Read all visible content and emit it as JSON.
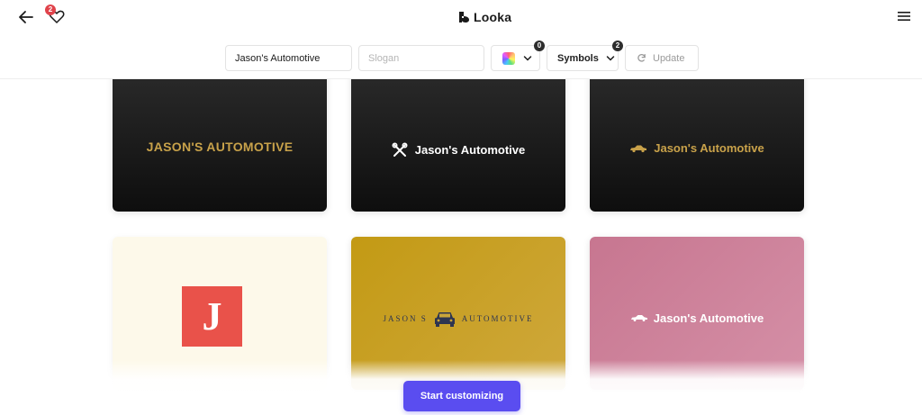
{
  "header": {
    "brand_name": "Looka",
    "favorites_count": "2"
  },
  "toolbar": {
    "company_name_value": "Jason's Automotive",
    "slogan_placeholder": "Slogan",
    "colors_count": "0",
    "symbols_label": "Symbols",
    "symbols_count": "2",
    "update_label": "Update"
  },
  "logos": [
    {
      "text": "JASON'S AUTOMOTIVE",
      "icon": "none"
    },
    {
      "text": "Jason's Automotive",
      "icon": "crossed-tools-icon"
    },
    {
      "text": "Jason's Automotive",
      "icon": "car-icon"
    },
    {
      "text": "J",
      "icon": "monogram"
    },
    {
      "text_left": "JASON S",
      "text_right": "AUTOMOTIVE",
      "icon": "car-front-icon"
    },
    {
      "text": "Jason's Automotive",
      "icon": "car-icon"
    }
  ],
  "cta": {
    "label": "Start customizing",
    "color": "#5a4df0"
  }
}
